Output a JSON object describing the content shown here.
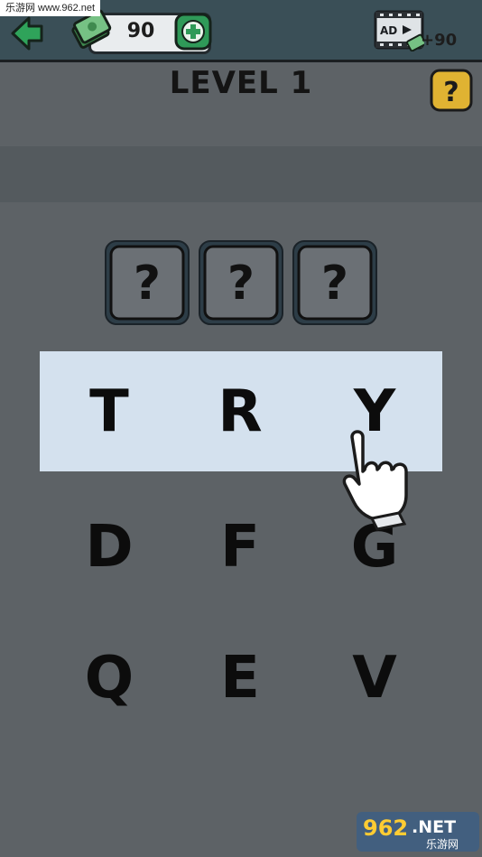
{
  "watermark": {
    "top_text": "乐游网 www.962.net",
    "bottom_brand": "962",
    "bottom_net": ".NET",
    "bottom_sub": "乐游网"
  },
  "header": {
    "coin_count": "90",
    "ad_label": "AD",
    "ad_bonus": "+90",
    "icons": [
      "back-arrow-icon",
      "cash-icon",
      "plus-icon",
      "video-ad-icon",
      "question-icon"
    ]
  },
  "level": {
    "title": "LEVEL 1"
  },
  "answer_slots": [
    "?",
    "?",
    "?"
  ],
  "keyboard": {
    "rows": [
      [
        "T",
        "R",
        "Y"
      ],
      [
        "D",
        "F",
        "G"
      ],
      [
        "Q",
        "E",
        "V"
      ]
    ]
  },
  "colors": {
    "background": "#5d6266",
    "header": "#3a4f57",
    "highlight": "#d4e1ee",
    "accent_green": "#2f9a58"
  }
}
